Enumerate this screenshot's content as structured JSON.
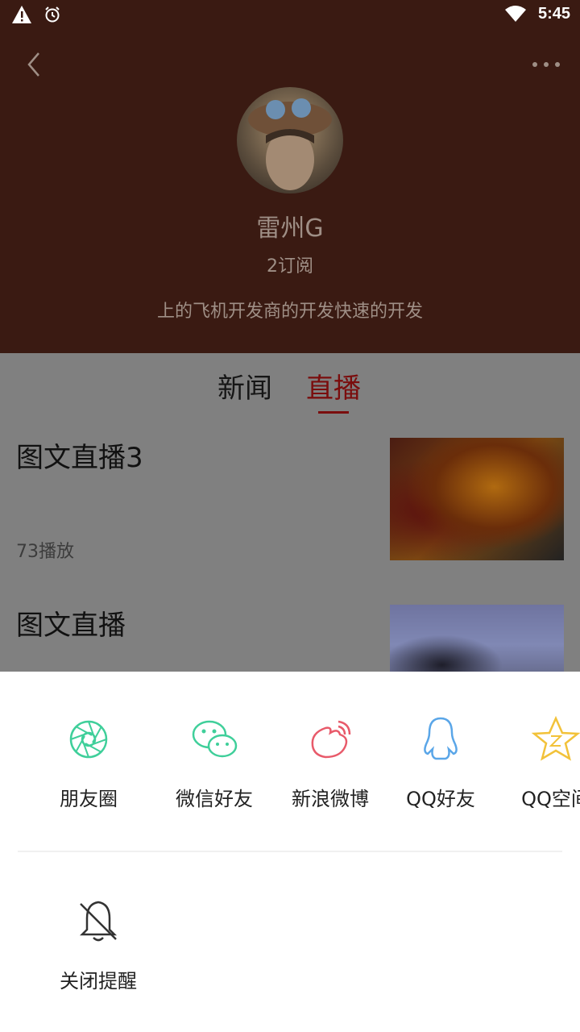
{
  "status_bar": {
    "time": "5:45",
    "icons": [
      "warning-icon",
      "alarm-icon",
      "wifi-icon"
    ]
  },
  "header": {
    "background_color": "#3a1a12",
    "back_icon": "chevron-left-icon",
    "more_icon": "more-dots-icon"
  },
  "profile": {
    "name": "雷州G",
    "subscribers": "2订阅",
    "description": "上的飞机开发商的开发快速的开发"
  },
  "tabs": [
    {
      "label": "新闻",
      "active": false
    },
    {
      "label": "直播",
      "active": true
    }
  ],
  "items": [
    {
      "title": "图文直播3",
      "plays": "73播放"
    },
    {
      "title": "图文直播"
    }
  ],
  "share": {
    "items": [
      {
        "label": "朋友圈",
        "icon": "moments-icon",
        "color": "#3fcf9a"
      },
      {
        "label": "微信好友",
        "icon": "wechat-icon",
        "color": "#3fcf9a"
      },
      {
        "label": "新浪微博",
        "icon": "weibo-icon",
        "color": "#e85a6a"
      },
      {
        "label": "QQ好友",
        "icon": "qq-icon",
        "color": "#5aa6e8"
      },
      {
        "label": "QQ空间",
        "icon": "qzone-icon",
        "color": "#f2c23a"
      }
    ],
    "actions": [
      {
        "label": "关闭提醒",
        "icon": "bell-off-icon"
      }
    ]
  },
  "colors": {
    "accent": "#7a0d0d",
    "overlay": "#808080"
  }
}
